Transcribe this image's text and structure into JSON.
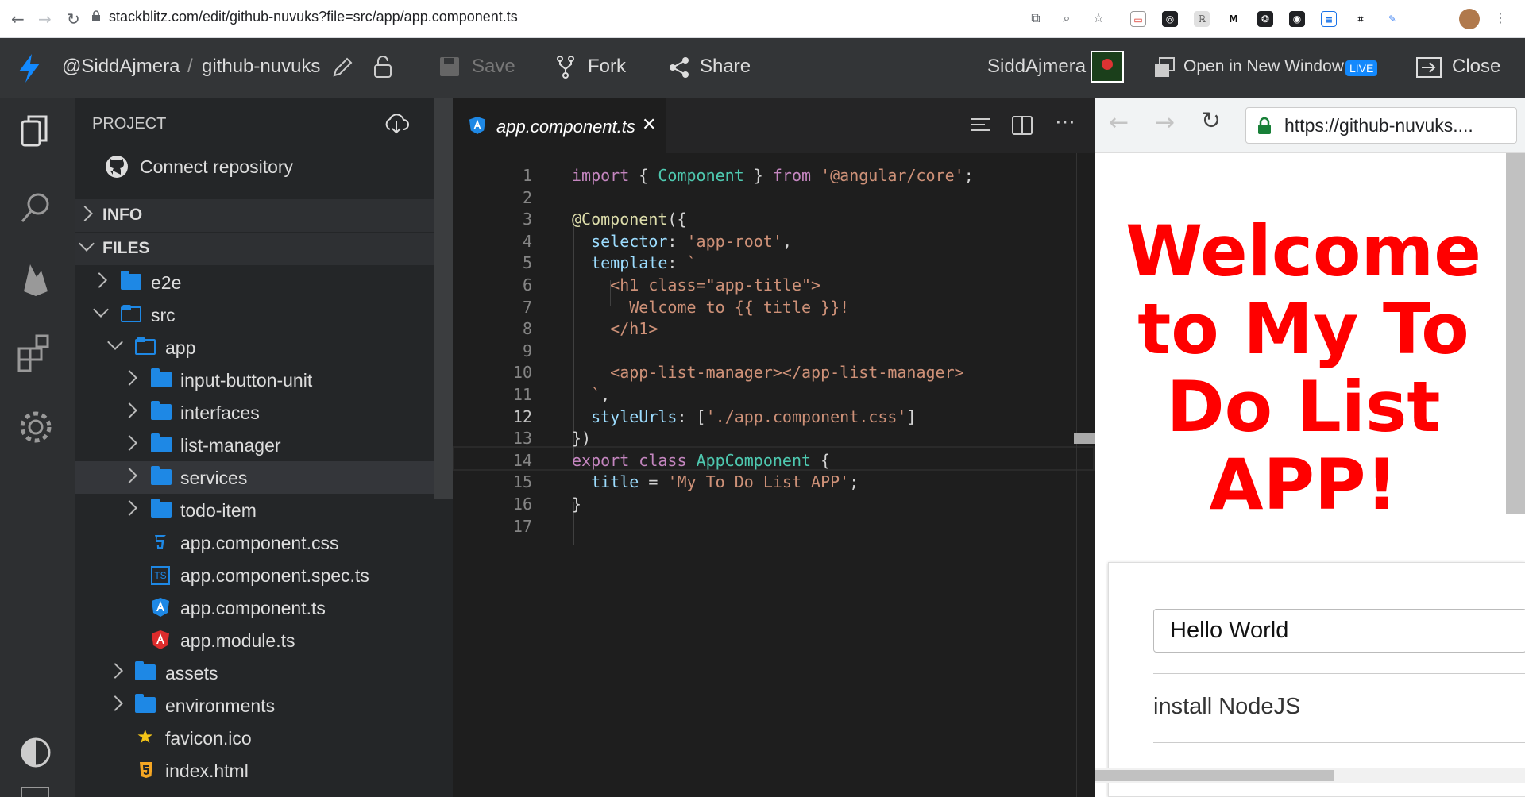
{
  "browser": {
    "url": "stackblitz.com/edit/github-nuvuks?file=src/app/app.component.ts"
  },
  "topbar": {
    "user_path": "@SiddAjmera",
    "separator": "/",
    "project_name": "github-nuvuks",
    "save_label": "Save",
    "fork_label": "Fork",
    "share_label": "Share",
    "username": "SiddAjmera",
    "open_new_window_label": "Open in New Window",
    "live_badge": "LIVE",
    "close_label": "Close"
  },
  "explorer": {
    "header": "PROJECT",
    "connect_repo": "Connect repository",
    "info_label": "INFO",
    "files_label": "FILES",
    "tree": [
      {
        "label": "e2e",
        "type": "folder",
        "state": "collapsed"
      },
      {
        "label": "src",
        "type": "folder",
        "state": "expanded"
      },
      {
        "label": "app",
        "type": "folder",
        "state": "expanded"
      },
      {
        "label": "input-button-unit",
        "type": "folder",
        "state": "collapsed"
      },
      {
        "label": "interfaces",
        "type": "folder",
        "state": "collapsed"
      },
      {
        "label": "list-manager",
        "type": "folder",
        "state": "collapsed"
      },
      {
        "label": "services",
        "type": "folder",
        "state": "collapsed",
        "selected": true
      },
      {
        "label": "todo-item",
        "type": "folder",
        "state": "collapsed"
      },
      {
        "label": "app.component.css",
        "type": "css-file"
      },
      {
        "label": "app.component.spec.ts",
        "type": "ts-file"
      },
      {
        "label": "app.component.ts",
        "type": "angular-file"
      },
      {
        "label": "app.module.ts",
        "type": "angular-module-file"
      },
      {
        "label": "assets",
        "type": "folder",
        "state": "collapsed"
      },
      {
        "label": "environments",
        "type": "folder",
        "state": "collapsed"
      },
      {
        "label": "favicon.ico",
        "type": "favicon-file"
      },
      {
        "label": "index.html",
        "type": "html-file"
      }
    ]
  },
  "editor": {
    "tab_name": "app.component.ts",
    "tab_close": "✕",
    "line_numbers": [
      "1",
      "2",
      "3",
      "4",
      "5",
      "6",
      "7",
      "8",
      "9",
      "10",
      "11",
      "12",
      "13",
      "14",
      "15",
      "16",
      "17"
    ],
    "lines": [
      "import { Component } from '@angular/core';",
      "",
      "@Component({",
      "  selector: 'app-root',",
      "  template: `",
      "    <h1 class=\"app-title\">",
      "      Welcome to {{ title }}!",
      "    </h1>",
      "",
      "    <app-list-manager></app-list-manager>",
      "  `,",
      "  styleUrls: ['./app.component.css']",
      "})",
      "export class AppComponent {",
      "  title = 'My To Do List APP';",
      "}",
      ""
    ]
  },
  "preview": {
    "url": "https://github-nuvuks....",
    "heading": "Welcome to My To Do List APP!",
    "input_value": "Hello World",
    "list_items": [
      "install NodeJS"
    ]
  }
}
